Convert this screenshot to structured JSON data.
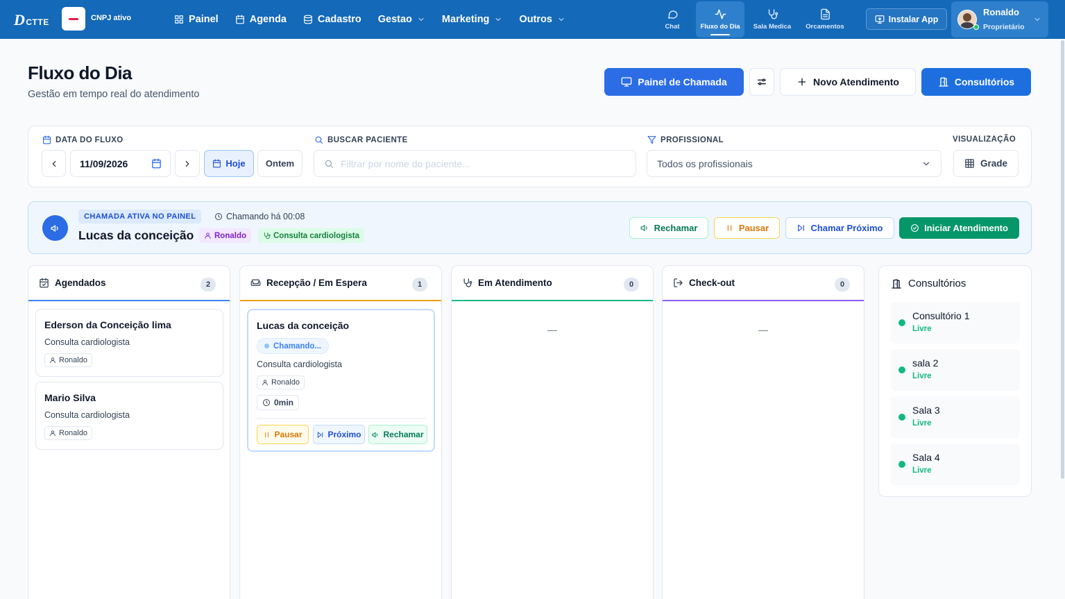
{
  "nav": {
    "logo_letter": "D",
    "logo_rest": "CTTE",
    "company_status": "CNPJ ativo",
    "menu": [
      {
        "label": "Painel"
      },
      {
        "label": "Agenda"
      },
      {
        "label": "Cadastro"
      },
      {
        "label": "Gestao"
      },
      {
        "label": "Marketing"
      },
      {
        "label": "Outros"
      }
    ],
    "quick": [
      {
        "label": "Chat"
      },
      {
        "label": "Fluxo do Dia"
      },
      {
        "label": "Sala Medica"
      },
      {
        "label": "Orcamentos"
      }
    ],
    "install_label": "Instalar App",
    "user": {
      "name": "Ronaldo",
      "role": "Proprietário"
    }
  },
  "header": {
    "title": "Fluxo do Dia",
    "subtitle": "Gestão em tempo real do atendimento",
    "btn_panel": "Painel de Chamada",
    "btn_new": "Novo Atendimento",
    "btn_rooms": "Consultórios"
  },
  "filters": {
    "date_label": "DATA DO FLUXO",
    "date_value": "11/09/2026",
    "today": "Hoje",
    "yesterday": "Ontem",
    "search_label": "BUSCAR PACIENTE",
    "search_placeholder": "Filtrar por nome do paciente...",
    "prof_label": "PROFISSIONAL",
    "prof_value": "Todos os profissionais",
    "view_label": "VISUALIZAÇÃO",
    "view_value": "Grade"
  },
  "active_call": {
    "tag": "CHAMADA ATIVA NO PAINEL",
    "timer": "Chamando há 00:08",
    "patient": "Lucas da conceição",
    "professional": "Ronaldo",
    "service": "Consulta cardiologista",
    "btn_recall": "Rechamar",
    "btn_pause": "Pausar",
    "btn_next": "Chamar Próximo",
    "btn_start": "Iniciar Atendimento"
  },
  "columns": [
    {
      "title": "Agendados",
      "count": "2"
    },
    {
      "title": "Recepção / Em Espera",
      "count": "1"
    },
    {
      "title": "Em Atendimento",
      "count": "0",
      "empty": "—"
    },
    {
      "title": "Check-out",
      "count": "0",
      "empty": "—"
    }
  ],
  "scheduled": [
    {
      "name": "Ederson da Conceição lima",
      "service": "Consulta cardiologista",
      "professional": "Ronaldo"
    },
    {
      "name": "Mario Silva",
      "service": "Consulta cardiologista",
      "professional": "Ronaldo"
    }
  ],
  "waiting": {
    "name": "Lucas da conceição",
    "status": "Chamando...",
    "service": "Consulta cardiologista",
    "professional": "Ronaldo",
    "time": "0min",
    "btn_pause": "Pausar",
    "btn_next": "Próximo",
    "btn_recall": "Rechamar"
  },
  "rooms": {
    "title": "Consultórios",
    "items": [
      {
        "name": "Consultório 1",
        "status": "Livre"
      },
      {
        "name": "sala 2",
        "status": "Livre"
      },
      {
        "name": "Sala 3",
        "status": "Livre"
      },
      {
        "name": "Sala 4",
        "status": "Livre"
      }
    ]
  },
  "colors": {
    "nav_bg": "#1469b8",
    "primary": "#2c6de6",
    "success": "#10b981",
    "warning": "#d97706"
  }
}
